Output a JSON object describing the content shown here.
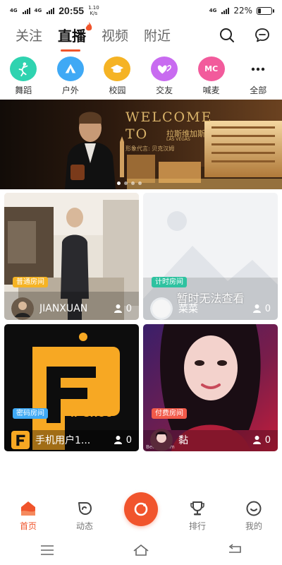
{
  "status_bar": {
    "network_left": "4G",
    "network_left2": "4G",
    "time": "20:55",
    "speed_value": "1.10",
    "speed_unit": "K/s",
    "network_right": "4G",
    "battery_percent": "22%",
    "battery_level": 0.22
  },
  "top_tabs": [
    {
      "label": "关注",
      "active": false
    },
    {
      "label": "直播",
      "active": true
    },
    {
      "label": "视频",
      "active": false
    },
    {
      "label": "附近",
      "active": false
    }
  ],
  "top_icons": [
    "search-icon",
    "message-icon"
  ],
  "categories": [
    {
      "label": "舞蹈",
      "icon": "dance-icon",
      "color": "#2fd3b0"
    },
    {
      "label": "户外",
      "icon": "tent-icon",
      "color": "#3fa9f5"
    },
    {
      "label": "校园",
      "icon": "graduation-cap-icon",
      "color": "#f5b324"
    },
    {
      "label": "交友",
      "icon": "hearts-icon",
      "color": "#c86bf0"
    },
    {
      "label": "喊麦",
      "icon": "mc-icon",
      "color": "#f25b9c",
      "text": "MC"
    },
    {
      "label": "全部",
      "icon": "more-icon",
      "color": "#ffffff"
    }
  ],
  "banner": {
    "line1": "WELCOME",
    "line2": "TO",
    "brand_cn": "拉斯维加斯",
    "brand_en": "LAS VEGAS",
    "endorse": "形象代言: 贝克汉姆",
    "page_count": 4,
    "active_page": 1
  },
  "rooms": [
    {
      "tag": "普通房间",
      "tag_color": "#f5b324",
      "name": "JIANXUAN",
      "viewers": "0",
      "bg": "room"
    },
    {
      "tag": "计时房间",
      "tag_color": "#2fc2a0",
      "name": "菜菜",
      "viewers": "0",
      "bg": "placeholder",
      "overlay": "暂时无法查看"
    },
    {
      "tag": "密码房间",
      "tag_color": "#3fa9f5",
      "name": "手机用户1...",
      "viewers": "0",
      "bg": "logo",
      "logo_text": "IF SHOU"
    },
    {
      "tag": "付费房间",
      "tag_color": "#f25a4a",
      "name": "黏",
      "viewers": "0",
      "bg": "portrait",
      "watermark": "BeautyCam"
    }
  ],
  "bottom_nav": [
    {
      "label": "首页",
      "icon": "home-icon",
      "active": true
    },
    {
      "label": "动态",
      "icon": "moments-icon",
      "active": false
    },
    {
      "label": "",
      "icon": "camera-live-icon",
      "active": false
    },
    {
      "label": "排行",
      "icon": "trophy-icon",
      "active": false
    },
    {
      "label": "我的",
      "icon": "profile-icon",
      "active": false
    }
  ],
  "system_nav": [
    "menu-icon",
    "home-outline-icon",
    "back-icon"
  ],
  "colors": {
    "accent": "#f0542b"
  }
}
